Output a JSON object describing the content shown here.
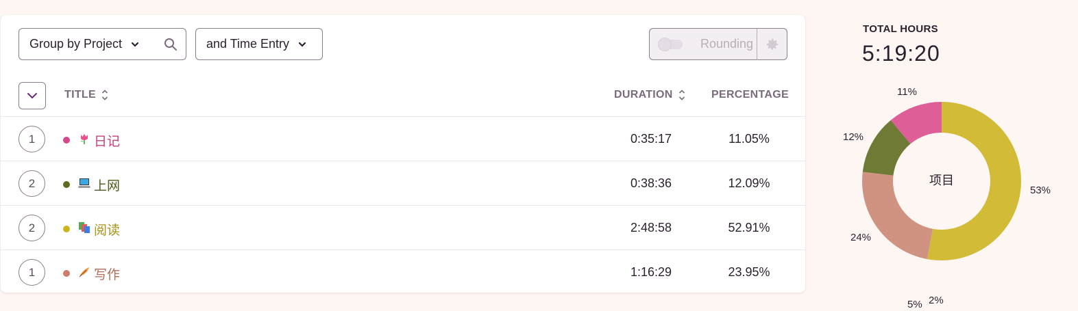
{
  "toolbar": {
    "group_by_label": "Group by Project",
    "secondary_group_label": "and Time Entry",
    "rounding_label": "Rounding"
  },
  "table": {
    "columns": {
      "title": "TITLE",
      "duration": "DURATION",
      "percentage": "PERCENTAGE"
    },
    "rows": [
      {
        "count": "1",
        "title": "日记",
        "duration": "0:35:17",
        "percentage": "11.05%",
        "color": "#d6478b",
        "text_color": "#c2417d",
        "icon": "tulip-icon"
      },
      {
        "count": "2",
        "title": "上网",
        "duration": "0:38:36",
        "percentage": "12.09%",
        "color": "#5c6b1f",
        "text_color": "#4d5a1a",
        "icon": "laptop-icon"
      },
      {
        "count": "2",
        "title": "阅读",
        "duration": "2:48:58",
        "percentage": "52.91%",
        "color": "#cdb51f",
        "text_color": "#a8921a",
        "icon": "books-icon"
      },
      {
        "count": "1",
        "title": "写作",
        "duration": "1:16:29",
        "percentage": "23.95%",
        "color": "#c98068",
        "text_color": "#b06e58",
        "icon": "feather-icon"
      }
    ]
  },
  "summary": {
    "title": "TOTAL HOURS",
    "total": "5:19:20"
  },
  "chart_data": {
    "type": "pie",
    "center_label": "项目",
    "slices": [
      {
        "label": "53%",
        "value": 52.91,
        "color": "#d1bb37"
      },
      {
        "label": "24%",
        "value": 23.95,
        "color": "#d09382"
      },
      {
        "label": "12%",
        "value": 12.09,
        "color": "#6f7a35"
      },
      {
        "label": "11%",
        "value": 11.05,
        "color": "#de5e98"
      }
    ],
    "extra_labels": [
      "5%",
      "2%"
    ]
  }
}
